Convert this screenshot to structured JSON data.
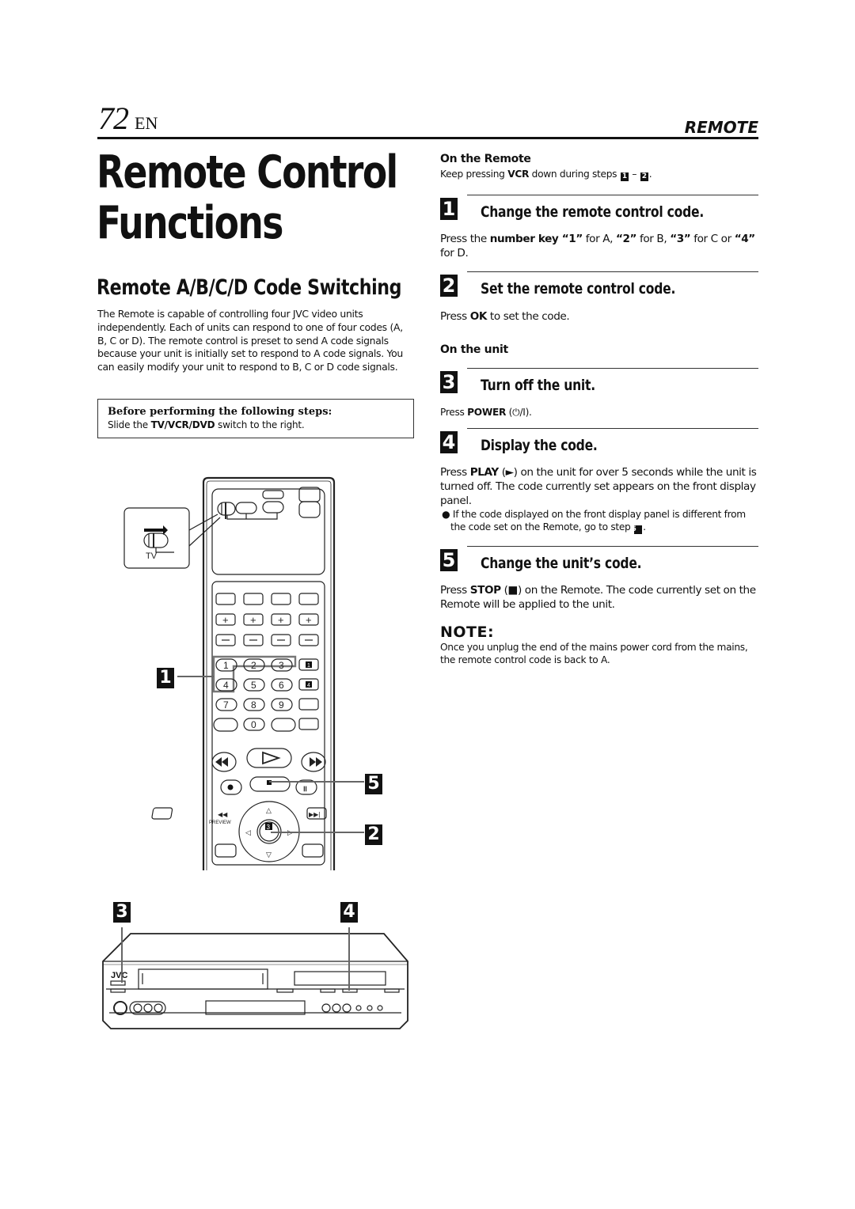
{
  "header": {
    "page_number": "72",
    "language": "EN",
    "section": "REMOTE"
  },
  "title": {
    "line1": "Remote Control",
    "line2": "Functions"
  },
  "subtitle": "Remote A/B/C/D Code Switching",
  "intro": "The Remote is capable of controlling four JVC video units independently. Each of units can respond to one of four codes (A, B, C or D). The remote control is preset to send A code signals because your unit is initially set to respond to A code signals. You can easily modify your unit to respond to B, C or D code signals.",
  "prebox": {
    "heading": "Before performing the following steps:",
    "text_before": "Slide the ",
    "text_bold": "TV/VCR/DVD",
    "text_after": " switch to the right."
  },
  "on_remote": {
    "heading": "On the Remote",
    "text_before": "Keep pressing ",
    "text_bold": "VCR",
    "text_mid": " down during steps ",
    "step_a": "1",
    "dash": " – ",
    "step_b": "2",
    "text_after": "."
  },
  "on_unit": {
    "heading": "On the unit"
  },
  "steps": [
    {
      "number": "1",
      "label": "Change the remote control code.",
      "body_parts": [
        "Press the ",
        "number key “1”",
        " for A, ",
        "“2”",
        " for B, ",
        "“3”",
        " for C or ",
        "“4”",
        " for D."
      ]
    },
    {
      "number": "2",
      "label": "Set the remote control code.",
      "body_parts": [
        "Press ",
        "OK",
        " to set the code."
      ]
    },
    {
      "number": "3",
      "label": "Turn off the unit.",
      "body_parts": [
        "Press ",
        "POWER",
        " (⏻/I)."
      ]
    },
    {
      "number": "4",
      "label": "Display the code.",
      "body_parts": [
        "Press ",
        "PLAY",
        " (►) on the unit for over 5 seconds while the unit is turned off. The code currently set appears on the front display panel."
      ],
      "bullet_text": "If the code displayed on the front display panel is different from the code set on the Remote, go to step ",
      "bullet_step": "5",
      "bullet_end": "."
    },
    {
      "number": "5",
      "label": "Change the unit’s code.",
      "body_parts": [
        "Press ",
        "STOP",
        " (■) on the Remote. The code currently set on the Remote will be applied to the unit."
      ]
    }
  ],
  "note": {
    "heading": "NOTE:",
    "text": "Once you unplug the end of the mains power cord from the mains, the remote control code is back to A."
  },
  "illustration": {
    "switch_label": "TV",
    "keypad": [
      "1",
      "2",
      "3",
      "4",
      "5",
      "6",
      "7",
      "8",
      "9",
      "0"
    ],
    "side_keys": [
      "1",
      "4"
    ],
    "callouts": [
      "1",
      "5",
      "2",
      "3",
      "4"
    ],
    "ok_badge": "3",
    "brand": "JVC",
    "preview_label": "PREVIEW"
  }
}
